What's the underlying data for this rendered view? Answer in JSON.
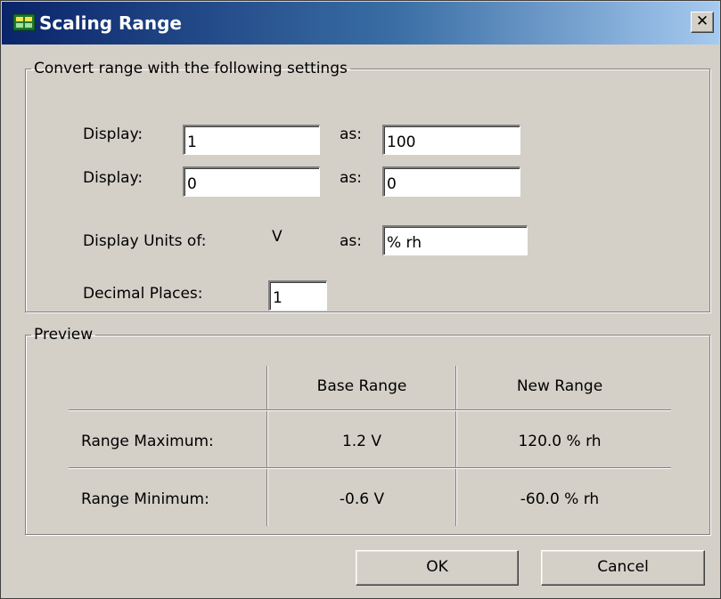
{
  "window": {
    "title": "Scaling Range",
    "close_glyph": "✕"
  },
  "convert_group": {
    "legend": "Convert range with the following settings",
    "row1": {
      "label": "Display:",
      "display_value": "1",
      "as_label": "as:",
      "as_value": "100"
    },
    "row2": {
      "label": "Display:",
      "display_value": "0",
      "as_label": "as:",
      "as_value": "0"
    },
    "units": {
      "label": "Display Units of:",
      "base_unit": "V",
      "as_label": "as:",
      "value": "% rh"
    },
    "decimals": {
      "label": "Decimal Places:",
      "value": "1"
    }
  },
  "preview_group": {
    "legend": "Preview",
    "columns": [
      "",
      "Base Range",
      "New Range"
    ],
    "rows": [
      [
        "Range Maximum:",
        "1.2 V",
        "120.0 % rh"
      ],
      [
        "Range Minimum:",
        "-0.6 V",
        "-60.0 % rh"
      ]
    ]
  },
  "buttons": {
    "ok": "OK",
    "cancel": "Cancel"
  },
  "colors": {
    "title_start": "#0a246a",
    "title_end": "#a6caf0",
    "dialog_bg": "#d4d0c8"
  }
}
